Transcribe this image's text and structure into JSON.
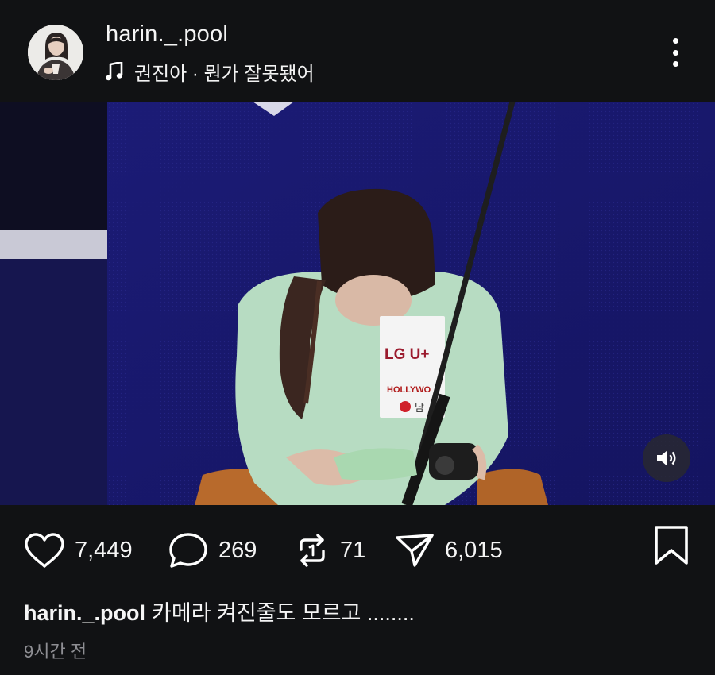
{
  "post": {
    "username": "harin._.pool",
    "music": "권진아 · 뭔가 잘못됐어",
    "likes": "7,449",
    "comments": "269",
    "reposts": "71",
    "shares": "6,015",
    "caption_user": "harin._.pool",
    "caption_text": "카메라 켜진줄도 모르고 ........",
    "time": "9시간 전"
  },
  "icons": {
    "music": "music-note-icon",
    "more": "more-vertical-icon",
    "volume": "volume-icon",
    "like": "heart-icon",
    "comment": "comment-bubble-icon",
    "repost": "repost-icon",
    "share": "send-icon",
    "save": "bookmark-icon"
  },
  "video_logos": [
    "LG U+",
    "HOLLYWO",
    "남"
  ],
  "colors": {
    "background": "#111214",
    "text": "#f5f5f5",
    "muted": "#8e8e93",
    "video_bg": "#1a1a6e"
  }
}
